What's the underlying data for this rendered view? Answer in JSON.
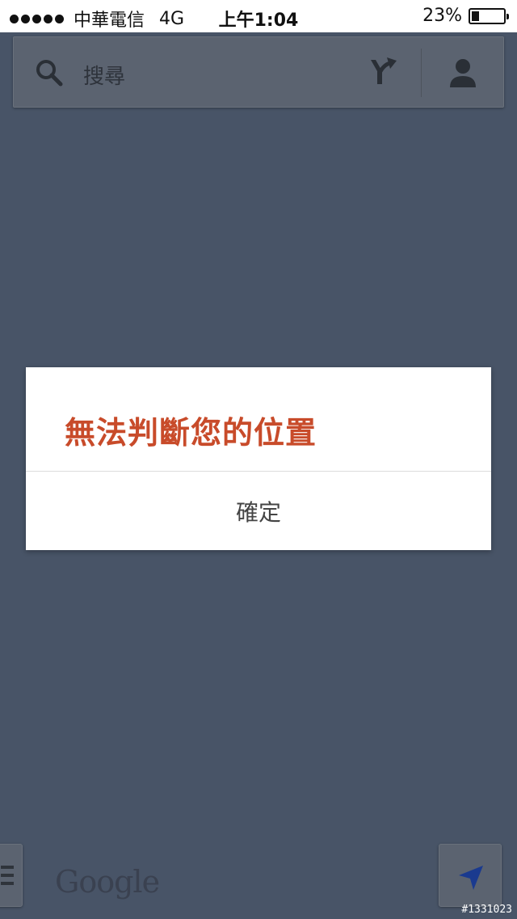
{
  "status_bar": {
    "carrier": "中華電信",
    "network": "4G",
    "time": "上午1:04",
    "battery": "23%",
    "battery_level": 0.23
  },
  "search_bar": {
    "placeholder": "搜尋",
    "search_icon": "search-icon",
    "directions_icon": "directions-icon",
    "account_icon": "account-icon"
  },
  "dialog": {
    "title": "無法判斷您的位置",
    "ok_label": "確定"
  },
  "map": {
    "logo": "Google",
    "menu_icon": "menu-icon",
    "location_icon": "my-location-icon"
  },
  "watermark": "#1331023",
  "colors": {
    "overlay": "#485467",
    "dialog_title": "#c84b2a",
    "location_icon": "#1a3a8f"
  }
}
